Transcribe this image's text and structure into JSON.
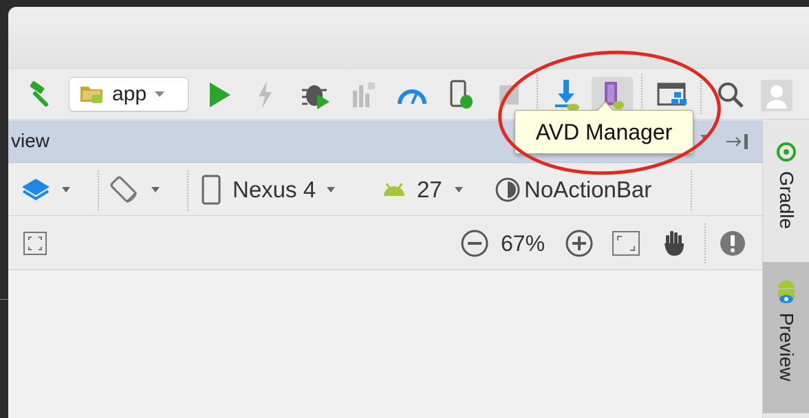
{
  "toolbar": {
    "run_config": "app"
  },
  "tooltip": {
    "text": "AVD Manager"
  },
  "panel": {
    "title": "view"
  },
  "design_toolbar": {
    "device": "Nexus 4",
    "api_level": "27",
    "theme": "NoActionBar"
  },
  "zoom_toolbar": {
    "zoom_level": "67%"
  },
  "right_strip": {
    "tabs": [
      {
        "label": "Gradle"
      },
      {
        "label": "Preview"
      }
    ]
  },
  "colors": {
    "highlight_circle": "#e02a20",
    "tooltip_bg": "#ffffe1",
    "panel_header": "#c9d3e3",
    "run_green": "#2aa62a",
    "android_green": "#a4c639",
    "accent_blue": "#1e88e5"
  }
}
